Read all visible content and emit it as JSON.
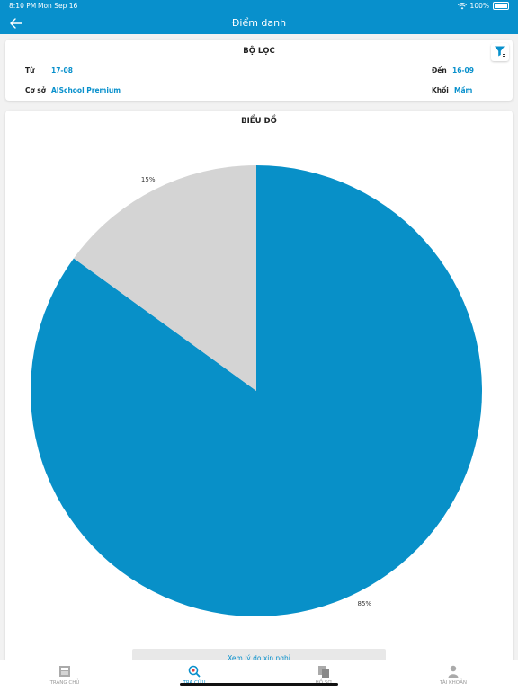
{
  "status": {
    "time": "8:10 PM",
    "date": "Mon Sep 16",
    "battery": "100%"
  },
  "nav": {
    "title": "Điểm danh"
  },
  "filter": {
    "title": "BỘ LỌC",
    "from_label": "Từ",
    "from_value": "17-08",
    "to_label": "Đến",
    "to_value": "16-09",
    "campus_label": "Cơ sở",
    "campus_value": "AISchool Premium",
    "grade_label": "Khối",
    "grade_value": "Mầm"
  },
  "chart": {
    "title": "BIỂU ĐỒ"
  },
  "chart_data": {
    "type": "pie",
    "slices": [
      {
        "label": "85%",
        "value": 85,
        "color": "#0890c8"
      },
      {
        "label": "15%",
        "value": 15,
        "color": "#d4d4d4"
      }
    ]
  },
  "view_button": "Xem lý do xin nghỉ",
  "tabs": [
    {
      "label": "TRANG CHỦ",
      "icon": "newspaper-icon"
    },
    {
      "label": "TRA CỨU",
      "icon": "search-icon"
    },
    {
      "label": "HỒ SƠ",
      "icon": "files-icon"
    },
    {
      "label": "TÀI KHOẢN",
      "icon": "user-icon"
    }
  ]
}
